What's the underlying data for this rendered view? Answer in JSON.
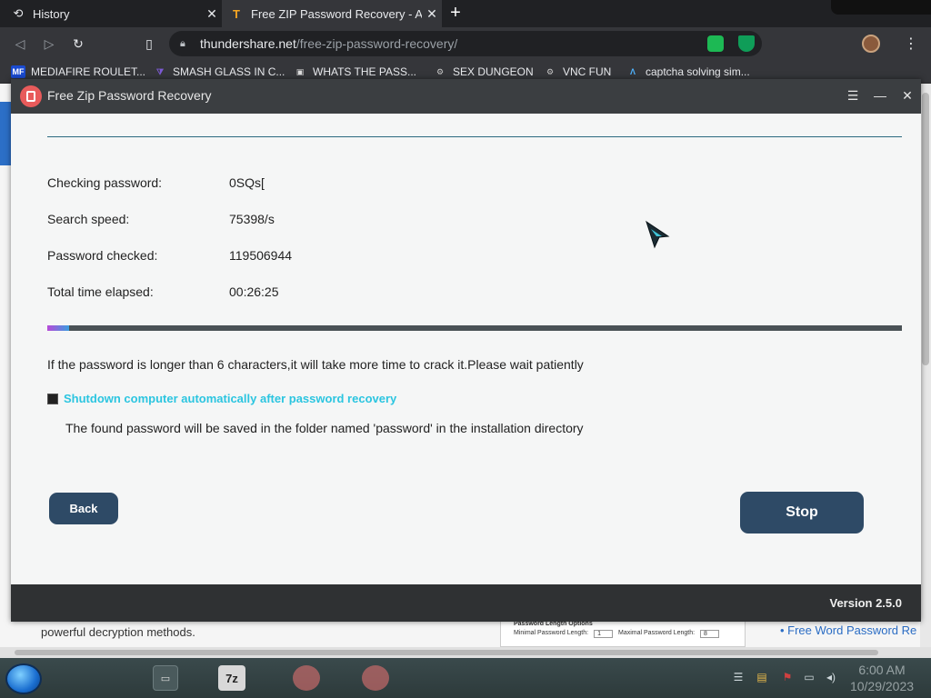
{
  "browser": {
    "tabs": [
      {
        "label": "History",
        "icon": "history-icon",
        "close": "✕"
      },
      {
        "label": "Free ZIP Password Recovery - A sc",
        "icon": "thundershare-icon",
        "close": "✕"
      }
    ],
    "new_tab": "+",
    "url_host": "thundershare.net",
    "url_path": "/free-zip-password-recovery/",
    "bookmarks": [
      {
        "label": "MEDIAFIRE ROULET...",
        "icon": "mediafire-icon",
        "icon_text": "MF"
      },
      {
        "label": "SMASH GLASS IN C...",
        "icon": "visual-studio-icon",
        "icon_text": "⧩"
      },
      {
        "label": "WHATS THE PASS...",
        "icon": "bookmark-icon",
        "icon_text": "▣"
      },
      {
        "label": "SEX DUNGEON",
        "icon": "gear-icon",
        "icon_text": "⚙"
      },
      {
        "label": "VNC FUN",
        "icon": "gear-icon",
        "icon_text": "⚙"
      },
      {
        "label": "captcha solving sim...",
        "icon": "arch-icon",
        "icon_text": "Λ"
      }
    ]
  },
  "webpage": {
    "bg_text": "powerful decryption methods.",
    "bg_image_title": "Password Length Options",
    "bg_image_min": "Minimal Password Length:",
    "bg_image_max": "Maximal Password Length:",
    "bg_image_min_value": "1",
    "bg_image_max_value": "8",
    "bg_link": "• Free Word Password Re"
  },
  "app": {
    "title": "Free Zip Password Recovery",
    "controls": {
      "menu": "☰",
      "minimize": "—",
      "close": "✕"
    },
    "rows": [
      {
        "label": "Checking password:",
        "value": "0SQs["
      },
      {
        "label": "Search speed:",
        "value": "75398/s"
      },
      {
        "label": "Password checked:",
        "value": "119506944"
      },
      {
        "label": "Total time elapsed:",
        "value": "00:26:25"
      }
    ],
    "progress_percent": 2.6,
    "note": "If the password is longer than 6 characters,it will take more time to crack it.Please wait patiently",
    "checkbox_label": "Shutdown computer automatically after password recovery",
    "checkbox_checked": true,
    "save_note": "The found password will be saved in the folder named 'password' in the installation directory",
    "back_label": "Back",
    "stop_label": "Stop",
    "version": "Version 2.5.0"
  },
  "taskbar": {
    "items": [
      {
        "name": "explorer-icon",
        "text": "▭"
      },
      {
        "name": "7zip-icon",
        "text": "7z"
      },
      {
        "name": "zip-recovery-icon",
        "text": ""
      },
      {
        "name": "zip-recovery-icon-2",
        "text": ""
      }
    ],
    "time": "6:00 AM",
    "date": "10/29/2023"
  },
  "colors": {
    "accent_cyan": "#2bc5e0",
    "button_blue": "#2e4a66",
    "progress_fill": "#7a6de0"
  }
}
